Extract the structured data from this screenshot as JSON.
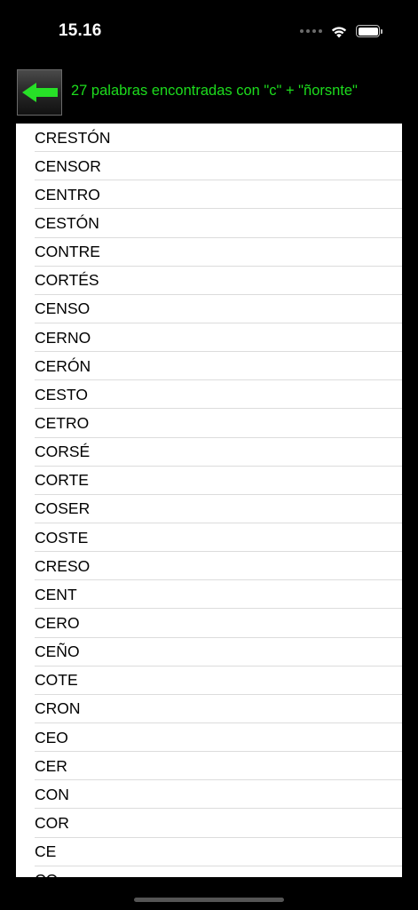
{
  "status_bar": {
    "time": "15.16"
  },
  "header": {
    "back_icon": "green-left-arrow-icon",
    "title": "27 palabras encontradas con \"c\" + \"ñorsnte\""
  },
  "words": [
    "CRESTÓN",
    "CENSOR",
    "CENTRO",
    "CESTÓN",
    "CONTRE",
    "CORTÉS",
    "CENSO",
    "CERNO",
    "CERÓN",
    "CESTO",
    "CETRO",
    "CORSÉ",
    "CORTE",
    "COSER",
    "COSTE",
    "CRESO",
    "CENT",
    "CERO",
    "CEÑO",
    "COTE",
    "CRON",
    "CEO",
    "CER",
    "CON",
    "COR",
    "CE",
    "CO"
  ],
  "colors": {
    "title_green": "#1ddc1d",
    "arrow_green": "#27e027",
    "background": "#000000"
  }
}
